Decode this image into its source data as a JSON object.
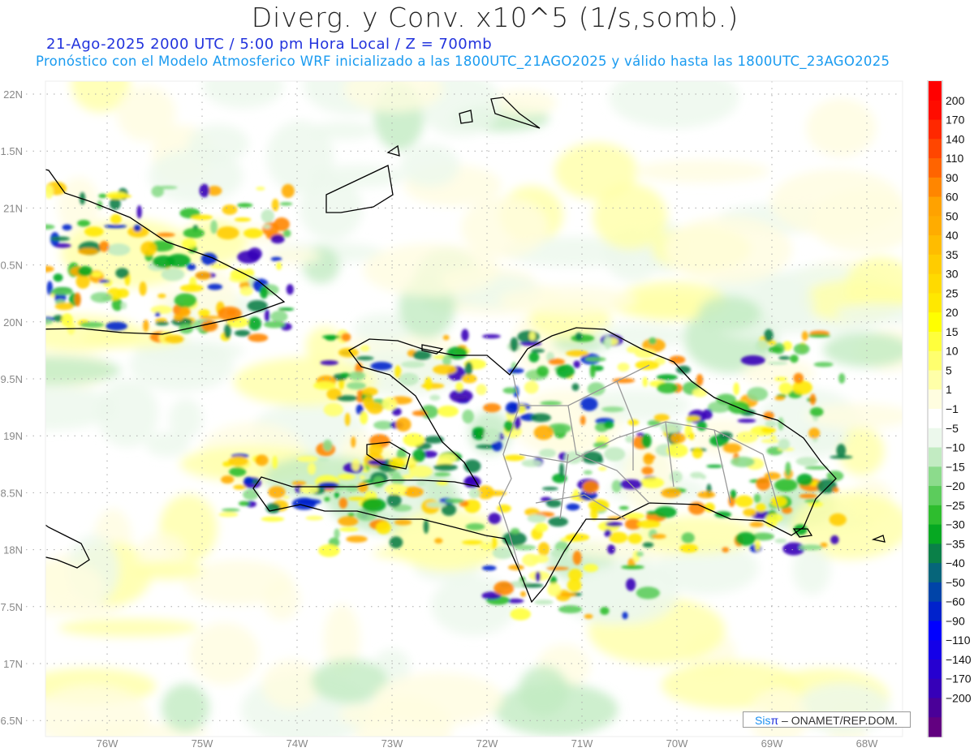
{
  "title": "Diverg. y Conv. x10^5 (1/s,somb.)",
  "subtitle_1": "21-Ago-2025  2000 UTC / 5:00 pm Hora Local / Z = 700mb",
  "subtitle_2": "Pronóstico con el Modelo Atmosferico WRF inicializado a las 1800UTC_21AGO2025 y válido hasta las  1800UTC_23AGO2025",
  "credit": {
    "brand": "Sis",
    "brand_symbol": "π",
    "text": " – ONAMET/REP.DOM."
  },
  "chart_data": {
    "type": "heatmap",
    "variable": "Divergencia (+) y Convergencia (-) x10^5 1/s",
    "level": "700mb",
    "lat_labels": [
      "22N",
      "1.5N",
      "21N",
      "0.5N",
      "20N",
      "9.5N",
      "19N",
      "8.5N",
      "18N",
      "7.5N",
      "17N",
      "6.5N"
    ],
    "lat_values": [
      22,
      21.5,
      21,
      20.5,
      20,
      19.5,
      19,
      18.5,
      18,
      17.5,
      17,
      16.5
    ],
    "lon_labels": [
      "76W",
      "75W",
      "74W",
      "73W",
      "72W",
      "71W",
      "70W",
      "69W",
      "68W"
    ],
    "lon_values": [
      -76,
      -75,
      -74,
      -73,
      -72,
      -71,
      -70,
      -69,
      -68
    ],
    "xlim": [
      -76.65,
      -67.63
    ],
    "ylim": [
      16.45,
      22.1
    ],
    "grid": true,
    "colorbar": {
      "position": "right",
      "labels": [
        "200",
        "170",
        "140",
        "110",
        "90",
        "60",
        "50",
        "40",
        "35",
        "30",
        "25",
        "20",
        "15",
        "10",
        "5",
        "1",
        "-1",
        "-5",
        "-10",
        "-15",
        "-20",
        "-25",
        "-30",
        "-35",
        "-40",
        "-50",
        "-60",
        "-90",
        "-110",
        "-140",
        "-170",
        "-200"
      ],
      "colors": [
        "#ff0000",
        "#ff0c00",
        "#ff2800",
        "#ff4600",
        "#ff6400",
        "#ff8600",
        "#ffa200",
        "#ffac00",
        "#ffbc00",
        "#ffcc00",
        "#ffda00",
        "#ffe800",
        "#ffff00",
        "#ffff3c",
        "#ffff6e",
        "#ffffa8",
        "#fffde0",
        "#ffffff",
        "#ecf8ec",
        "#c2ebc2",
        "#8cdb8c",
        "#5ccc5c",
        "#2ebd2e",
        "#06a822",
        "#0a8048",
        "#06657a",
        "#0044a8",
        "#0022cc",
        "#0000ff",
        "#1400e8",
        "#2600d0",
        "#3600b8",
        "#4a0098",
        "#620080"
      ]
    },
    "features": [
      "Cuba (oriente)",
      "La Hispaniola",
      "Jamaica",
      "Islas Turcas y Caicos",
      "Inagua",
      "Isla de la Gonâve"
    ]
  }
}
